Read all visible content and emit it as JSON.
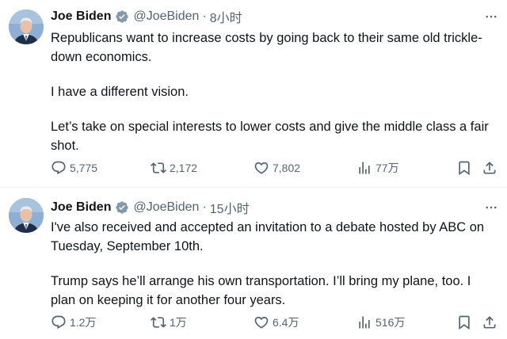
{
  "tweets": [
    {
      "author_name": "Joe Biden",
      "handle": "@JoeBiden",
      "separator": "·",
      "time": "8小时",
      "paragraphs": [
        "Republicans want to increase costs by going back to their same old trickle-down economics.",
        "I have a different vision.",
        "Let’s take on special interests to lower costs and give the middle class a fair shot."
      ],
      "replies": "5,775",
      "reposts": "2,172",
      "likes": "7,802",
      "views": "77万"
    },
    {
      "author_name": "Joe Biden",
      "handle": "@JoeBiden",
      "separator": "·",
      "time": "15小时",
      "paragraphs": [
        "I've also received and accepted an invitation to a debate hosted by ABC on Tuesday, September 10th.",
        "Trump says he’ll arrange his own transportation. I’ll bring my plane, too. I plan on keeping it for another four years."
      ],
      "replies": "1.2万",
      "reposts": "1万",
      "likes": "6.4万",
      "views": "516万"
    }
  ],
  "colors": {
    "text": "#0f1419",
    "secondary": "#536471",
    "verified_badge": "#829aab",
    "divider": "#eff3f4"
  },
  "icons": [
    "verified-badge-icon",
    "more-icon",
    "reply-icon",
    "repost-icon",
    "like-icon",
    "views-icon",
    "bookmark-icon",
    "share-icon"
  ]
}
